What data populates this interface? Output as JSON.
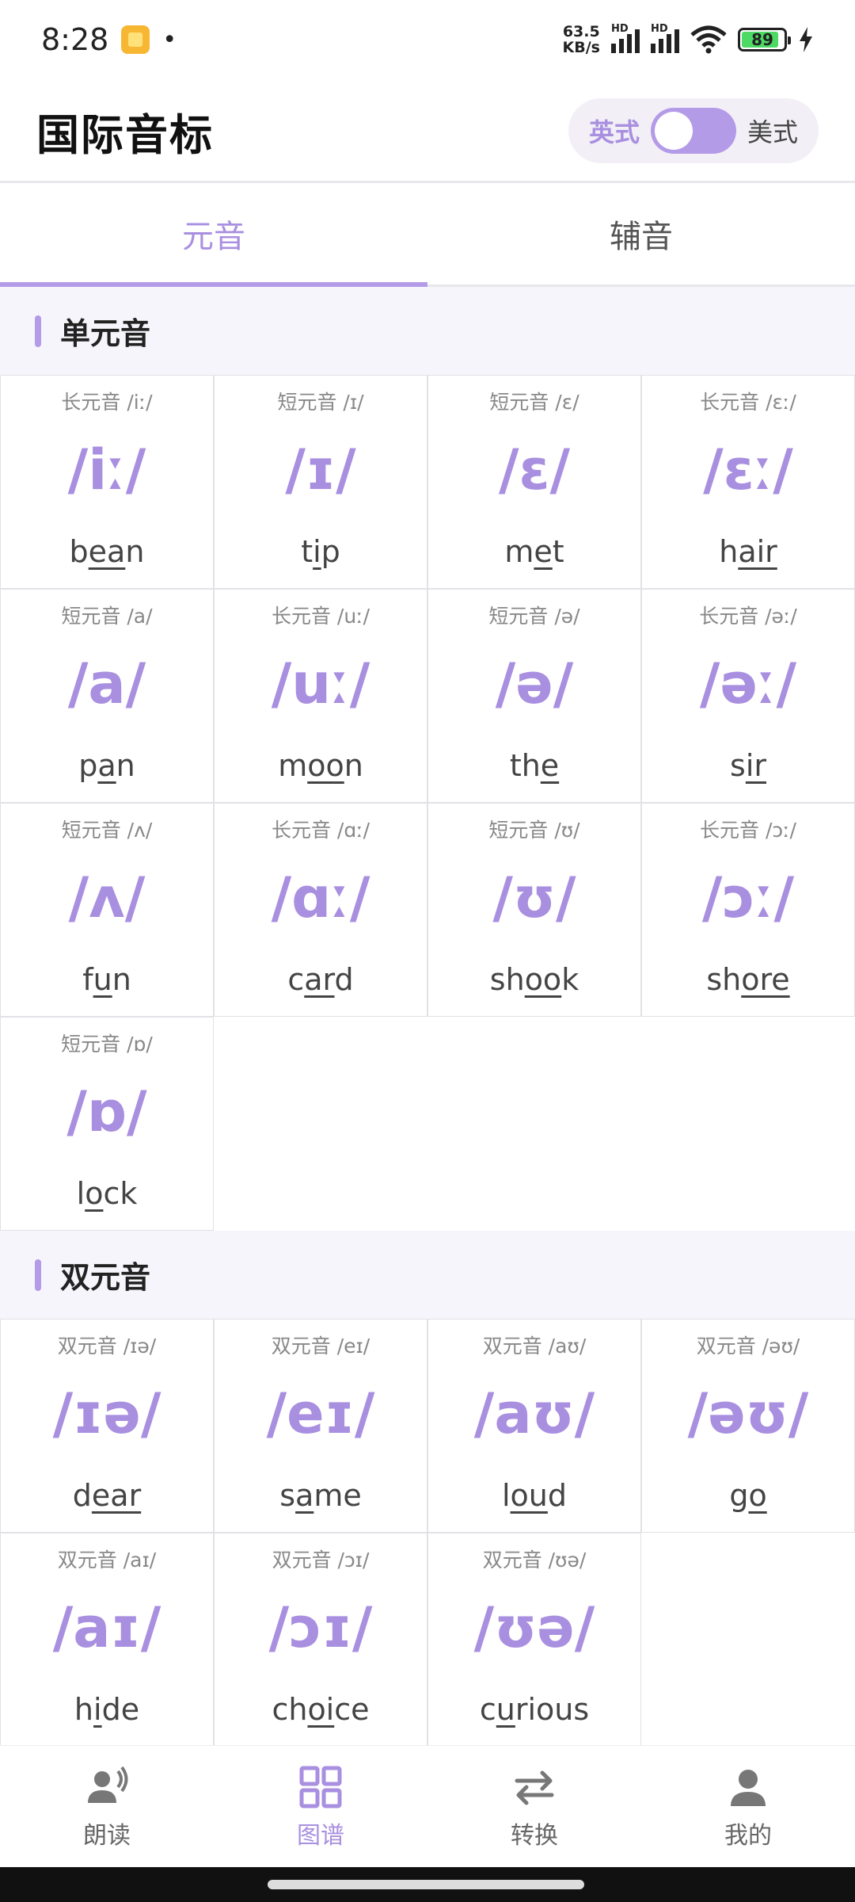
{
  "status_bar": {
    "time": "8:28",
    "dot": "•",
    "net_speed_value": "63.5",
    "net_speed_unit": "KB/s",
    "hd1": "HD",
    "hd2": "HD",
    "battery": "89"
  },
  "header": {
    "title": "国际音标",
    "toggle_left": "英式",
    "toggle_right": "美式"
  },
  "tabs": [
    {
      "label": "元音"
    },
    {
      "label": "辅音"
    }
  ],
  "sections": [
    {
      "title": "单元音",
      "cells": [
        {
          "kind": "长元音 /iː/",
          "symbol": "/iː/",
          "word_pre": "b",
          "word_ul": "ea",
          "word_post": "n"
        },
        {
          "kind": "短元音 /ɪ/",
          "symbol": "/ɪ/",
          "word_pre": "t",
          "word_ul": "i",
          "word_post": "p"
        },
        {
          "kind": "短元音 /ɛ/",
          "symbol": "/ɛ/",
          "word_pre": "m",
          "word_ul": "e",
          "word_post": "t"
        },
        {
          "kind": "长元音 /ɛː/",
          "symbol": "/ɛː/",
          "word_pre": "h",
          "word_ul": "air",
          "word_post": ""
        },
        {
          "kind": "短元音 /a/",
          "symbol": "/a/",
          "word_pre": "p",
          "word_ul": "a",
          "word_post": "n"
        },
        {
          "kind": "长元音 /uː/",
          "symbol": "/uː/",
          "word_pre": "m",
          "word_ul": "oo",
          "word_post": "n"
        },
        {
          "kind": "短元音 /ə/",
          "symbol": "/ə/",
          "word_pre": "th",
          "word_ul": "e",
          "word_post": ""
        },
        {
          "kind": "长元音 /əː/",
          "symbol": "/əː/",
          "word_pre": "s",
          "word_ul": "ir",
          "word_post": ""
        },
        {
          "kind": "短元音 /ʌ/",
          "symbol": "/ʌ/",
          "word_pre": "f",
          "word_ul": "u",
          "word_post": "n"
        },
        {
          "kind": "长元音 /ɑː/",
          "symbol": "/ɑː/",
          "word_pre": "c",
          "word_ul": "ar",
          "word_post": "d"
        },
        {
          "kind": "短元音 /ʊ/",
          "symbol": "/ʊ/",
          "word_pre": "sh",
          "word_ul": "oo",
          "word_post": "k"
        },
        {
          "kind": "长元音 /ɔː/",
          "symbol": "/ɔː/",
          "word_pre": "sh",
          "word_ul": "ore",
          "word_post": ""
        },
        {
          "kind": "短元音 /ɒ/",
          "symbol": "/ɒ/",
          "word_pre": "l",
          "word_ul": "o",
          "word_post": "ck"
        }
      ]
    },
    {
      "title": "双元音",
      "cells": [
        {
          "kind": "双元音 /ɪə/",
          "symbol": "/ɪə/",
          "word_pre": "d",
          "word_ul": "ear",
          "word_post": ""
        },
        {
          "kind": "双元音 /eɪ/",
          "symbol": "/eɪ/",
          "word_pre": "s",
          "word_ul": "a",
          "word_post": "me"
        },
        {
          "kind": "双元音 /aʊ/",
          "symbol": "/aʊ/",
          "word_pre": "l",
          "word_ul": "ou",
          "word_post": "d"
        },
        {
          "kind": "双元音 /əʊ/",
          "symbol": "/əʊ/",
          "word_pre": "g",
          "word_ul": "o",
          "word_post": ""
        },
        {
          "kind": "双元音 /aɪ/",
          "symbol": "/aɪ/",
          "word_pre": "h",
          "word_ul": "i",
          "word_post": "de"
        },
        {
          "kind": "双元音 /ɔɪ/",
          "symbol": "/ɔɪ/",
          "word_pre": "ch",
          "word_ul": "oi",
          "word_post": "ce"
        },
        {
          "kind": "双元音 /ʊə/",
          "symbol": "/ʊə/",
          "word_pre": "c",
          "word_ul": "u",
          "word_post": "rious"
        }
      ]
    }
  ],
  "bottom_nav": [
    {
      "label": "朗读",
      "icon": "speaking-person-icon"
    },
    {
      "label": "图谱",
      "icon": "grid-icon"
    },
    {
      "label": "转换",
      "icon": "swap-arrows-icon"
    },
    {
      "label": "我的",
      "icon": "person-icon"
    }
  ],
  "colors": {
    "accent": "#a98fe0",
    "accent_bar": "#b39be8",
    "section_bg": "#f6f5fb"
  }
}
